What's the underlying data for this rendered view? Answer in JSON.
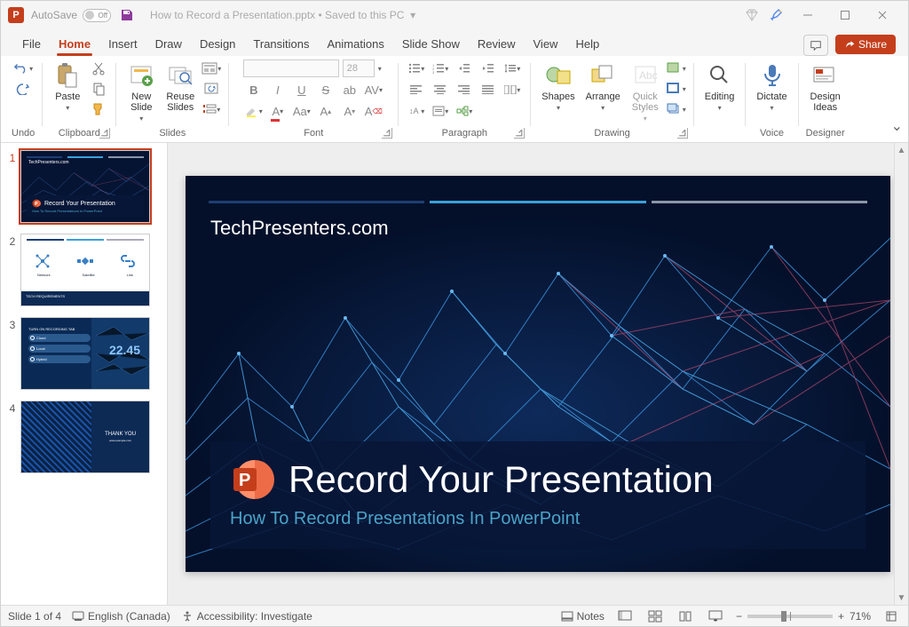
{
  "title": {
    "autosave": "AutoSave",
    "off": "Off",
    "filename": "How to Record a Presentation.pptx",
    "saved": "Saved to this PC"
  },
  "tabs": {
    "file": "File",
    "home": "Home",
    "insert": "Insert",
    "draw": "Draw",
    "design": "Design",
    "transitions": "Transitions",
    "animations": "Animations",
    "slideshow": "Slide Show",
    "review": "Review",
    "view": "View",
    "help": "Help",
    "share": "Share"
  },
  "ribbon": {
    "undo": "Undo",
    "paste": "Paste",
    "clipboard": "Clipboard",
    "newslide": "New\nSlide",
    "reuse": "Reuse\nSlides",
    "slides": "Slides",
    "font": "Font",
    "fontsize": "28",
    "paragraph": "Paragraph",
    "shapes": "Shapes",
    "arrange": "Arrange",
    "quick": "Quick\nStyles",
    "drawing": "Drawing",
    "editing": "Editing",
    "dictate": "Dictate",
    "voice": "Voice",
    "design": "Design\nIdeas",
    "designer": "Designer"
  },
  "slide": {
    "brand": "TechPresenters.com",
    "title": "Record Your Presentation",
    "subtitle": "How To Record Presentations In PowerPoint"
  },
  "thumbs": {
    "t1": {
      "brand": "TechPresenters.com",
      "title": "Record Your Presentation",
      "sub": "How To Record Presentations In PowerPoint"
    },
    "t2": {
      "l1": "Network",
      "l2": "Satellite",
      "l3": "Link",
      "footer": "TECH REQUIREMENTS"
    },
    "t3": {
      "hdr": "TURN ON RECORDING TAB",
      "o1": "Cloud",
      "o2": "Local",
      "o3": "Hybrid",
      "clock": "22.45"
    },
    "t4": {
      "thank": "THANK YOU",
      "small": "www.example.com"
    }
  },
  "status": {
    "slide": "Slide 1 of 4",
    "lang": "English (Canada)",
    "access": "Accessibility: Investigate",
    "notes": "Notes",
    "zoom": "71%"
  }
}
